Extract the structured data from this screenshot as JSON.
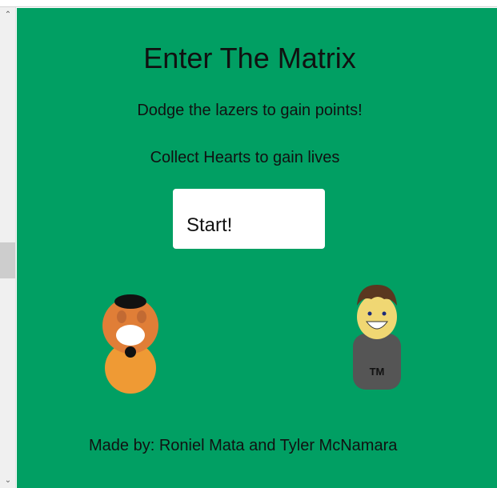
{
  "game": {
    "title": "Enter The Matrix",
    "instruction_1": "Dodge the lazers to gain points!",
    "instruction_2": "Collect Hearts to gain lives",
    "start_label": "Start!",
    "credits": "Made by: Roniel Mata and Tyler McNamara",
    "shirt_text": "TM",
    "background_color": "#019f63"
  },
  "scrollbar": {
    "up_icon": "chevron-up-icon",
    "down_icon": "chevron-down-icon"
  }
}
